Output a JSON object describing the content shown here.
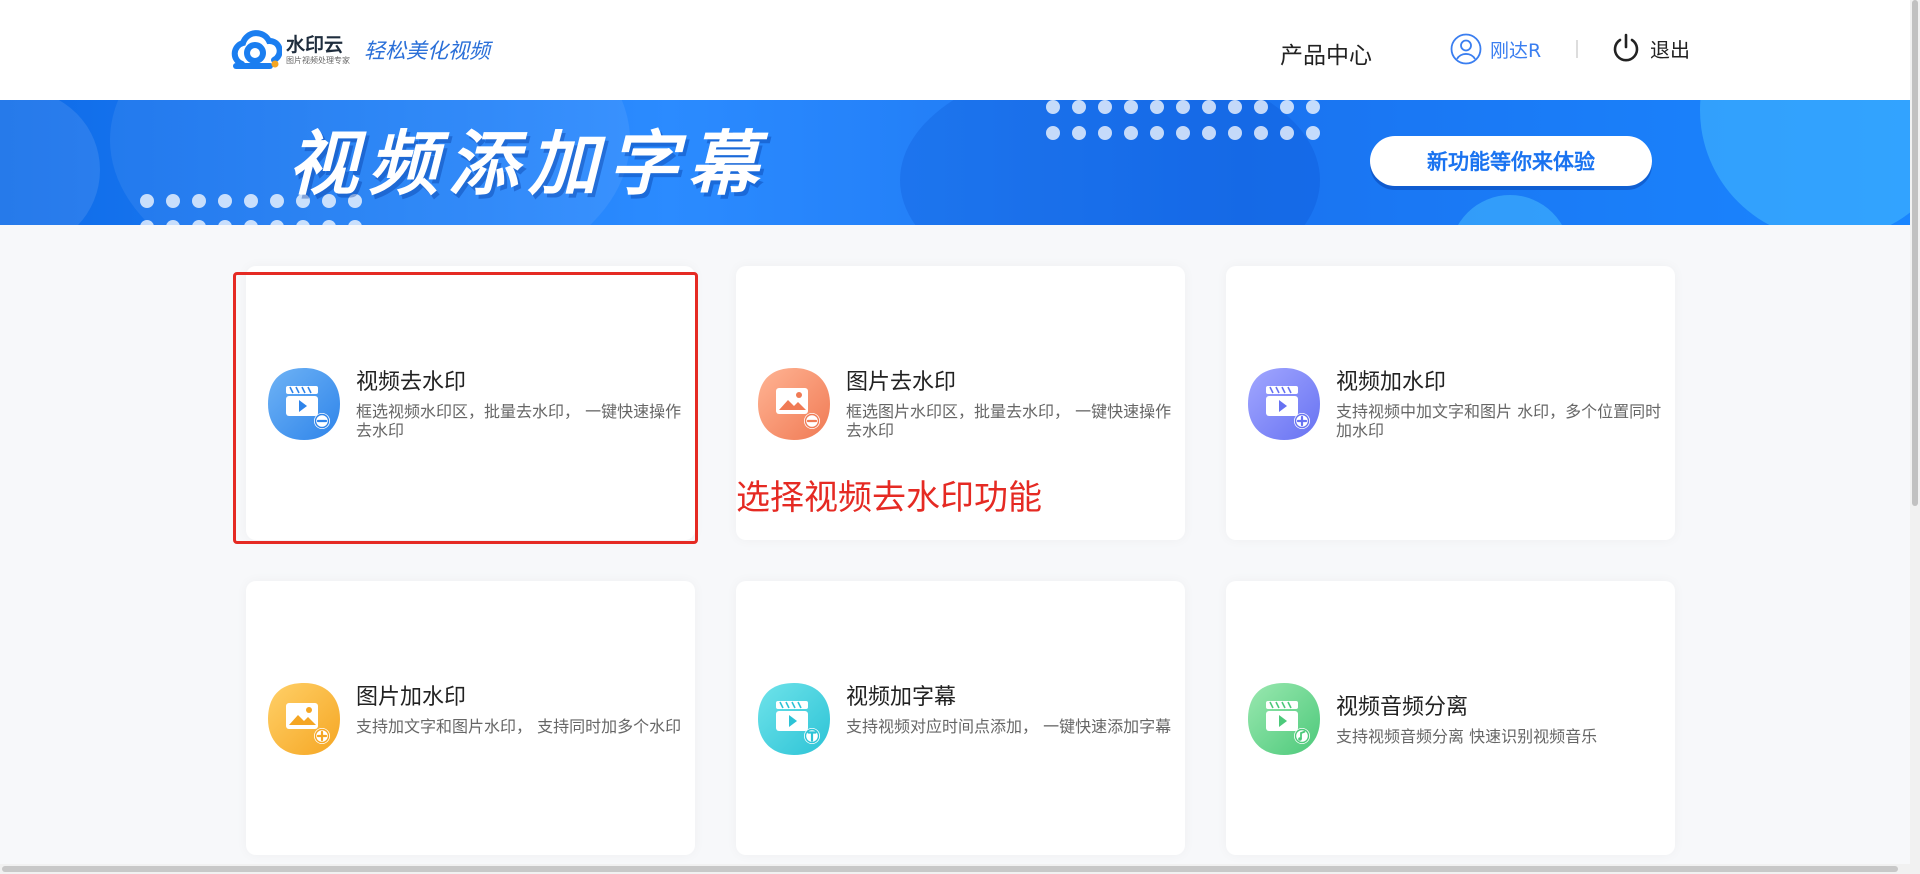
{
  "header": {
    "logo_name": "水印云",
    "logo_sub": "图片视频处理专家",
    "logo_slogan": "轻松美化视频",
    "nav_product": "产品中心",
    "username": "刚达R",
    "exit_label": "退出"
  },
  "banner": {
    "title": "视频添加字幕",
    "button_label": "新功能等你来体验"
  },
  "cards": [
    {
      "title": "视频去水印",
      "desc": "框选视频水印区，批量去水印， 一键快速操作去水印",
      "icon": "video-minus-icon",
      "color_from": "#6fb3f5",
      "color_to": "#2e84ea"
    },
    {
      "title": "图片去水印",
      "desc": "框选图片水印区，批量去水印， 一键快速操作去水印",
      "icon": "image-minus-icon",
      "color_from": "#ffb494",
      "color_to": "#f07a54"
    },
    {
      "title": "视频加水印",
      "desc": "支持视频中加文字和图片 水印，多个位置同时加水印",
      "icon": "video-plus-icon",
      "color_from": "#a2a7ff",
      "color_to": "#6772f2"
    },
    {
      "title": "图片加水印",
      "desc": "支持加文字和图片水印， 支持同时加多个水印",
      "icon": "image-plus-icon",
      "color_from": "#ffd068",
      "color_to": "#f5a623"
    },
    {
      "title": "视频加字幕",
      "desc": "支持视频对应时间点添加， 一键快速添加字幕",
      "icon": "video-text-icon",
      "color_from": "#6fe3ea",
      "color_to": "#2cc3d6"
    },
    {
      "title": "视频音频分离",
      "desc": "支持视频音频分离 快速识别视频音乐",
      "icon": "video-music-icon",
      "color_from": "#9ae8b0",
      "color_to": "#4cc97a"
    }
  ],
  "annotation": "选择视频去水印功能",
  "colors": {
    "accent": "#1a73f0",
    "annotation_red": "#e52a23"
  }
}
